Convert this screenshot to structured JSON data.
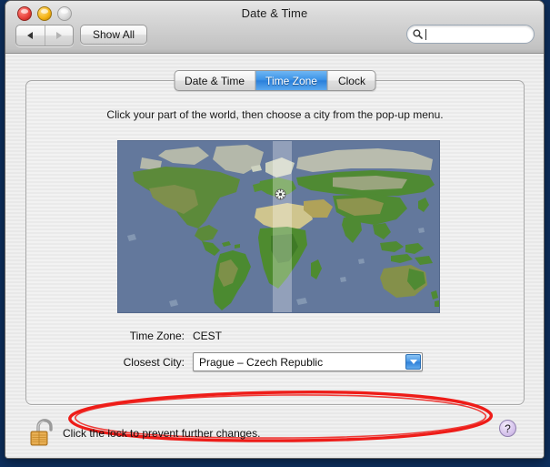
{
  "window": {
    "title": "Date & Time",
    "controls": {
      "close": "close-button",
      "minimize": "minimize-button",
      "zoom": "zoom-button"
    }
  },
  "toolbar": {
    "back_label": "◀",
    "forward_label": "▶",
    "show_all_label": "Show All",
    "search_placeholder": "",
    "search_value": "",
    "search_icon": "search-icon"
  },
  "tabs": [
    {
      "label": "Date & Time",
      "active": false
    },
    {
      "label": "Time Zone",
      "active": true
    },
    {
      "label": "Clock",
      "active": false
    }
  ],
  "main": {
    "instructions": "Click your part of the world, then choose a city from the pop-up menu.",
    "map": {
      "name": "world-map",
      "ocean_color": "#63789c",
      "land_color": "#4a7a33",
      "highland_color": "#8d9a5e",
      "tundra_color": "#b9bcae",
      "timezone_band_label": "selected-timezone-band",
      "city_marker_label": "selected-city-marker"
    },
    "fields": {
      "timezone_label": "Time Zone:",
      "timezone_value": "CEST",
      "closest_city_label": "Closest City:",
      "closest_city_value": "Prague – Czech Republic"
    },
    "help_label": "?"
  },
  "annotation": {
    "shape": "ellipse",
    "color": "#ee1c18",
    "targets": "closest-city-popup"
  },
  "footer": {
    "lock_icon": "open-padlock-icon",
    "lock_text": "Click the lock to prevent further changes."
  },
  "colors": {
    "accent_blue": "#2f80d8",
    "annotation_red": "#ee1c18",
    "help_purple": "#c3aade",
    "lock_gold": "#e2a13d"
  }
}
